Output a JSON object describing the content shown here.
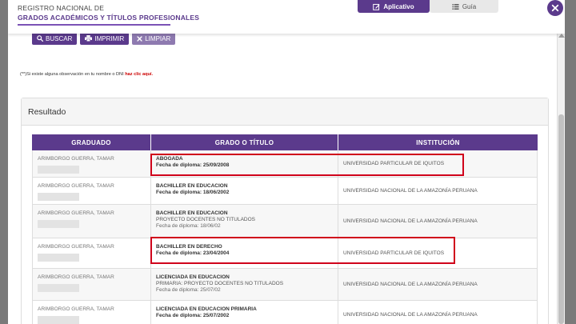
{
  "header": {
    "line1": "REGISTRO NACIONAL DE",
    "line2": "GRADOS ACADÉMICOS Y TÍTULOS PROFESIONALES"
  },
  "tabs": [
    {
      "label": "Aplicativo",
      "icon": "edit-icon"
    },
    {
      "label": "Guía",
      "icon": "list-icon"
    }
  ],
  "close_icon": "close-icon",
  "buttons": {
    "search": "BUSCAR",
    "print": "IMPRIMIR",
    "clear": "LIMPIAR"
  },
  "note": {
    "text": "(**)Si existe alguna observación en tu nombre o DNI",
    "link": "haz clic aquí."
  },
  "result": {
    "title": "Resultado",
    "columns": [
      "GRADUADO",
      "GRADO O TÍTULO",
      "INSTITUCIÓN"
    ],
    "rows": [
      {
        "graduate": "ARIMBORGO GUERRA, TAMAR",
        "degree": "ABOGADA",
        "sub": "",
        "date": "Fecha de diploma: 25/09/2008",
        "date_bold": true,
        "institution": "UNIVERSIDAD PARTICULAR DE IQUITOS"
      },
      {
        "graduate": "ARIMBORGO GUERRA, TAMAR",
        "degree": "BACHILLER EN EDUCACION",
        "sub": "",
        "date": "Fecha de diploma: 18/06/2002",
        "date_bold": true,
        "institution": "UNIVERSIDAD NACIONAL DE LA AMAZONÍA PERUANA"
      },
      {
        "graduate": "ARIMBORGO GUERRA, TAMAR",
        "degree": "BACHILLER EN EDUCACION",
        "sub": "PROYECTO DOCENTES NO TITULADOS",
        "date": "Fecha de diploma: 18/06/02",
        "date_bold": false,
        "institution": "UNIVERSIDAD NACIONAL DE LA AMAZONÍA PERUANA"
      },
      {
        "graduate": "ARIMBORGO GUERRA, TAMAR",
        "degree": "BACHILLER EN DERECHO",
        "sub": "",
        "date": "Fecha de diploma: 23/04/2004",
        "date_bold": true,
        "institution": "UNIVERSIDAD PARTICULAR DE IQUITOS"
      },
      {
        "graduate": "ARIMBORGO GUERRA, TAMAR",
        "degree": "LICENCIADA EN EDUCACION",
        "sub": "PRIMARIA: PROYECTO DOCENTES NO TITULADOS",
        "date": "Fecha de diploma: 25/07/02",
        "date_bold": false,
        "institution": "UNIVERSIDAD NACIONAL DE LA AMAZONÍA PERUANA"
      },
      {
        "graduate": "ARIMBORGO GUERRA, TAMAR",
        "degree": "LICENCIADA EN EDUCACION PRIMARIA",
        "sub": "",
        "date": "Fecha de diploma: 25/07/2002",
        "date_bold": true,
        "institution": "UNIVERSIDAD NACIONAL DE LA AMAZONÍA PERUANA"
      }
    ]
  },
  "colors": {
    "accent": "#5b3a8c",
    "highlight": "#d0021b"
  }
}
